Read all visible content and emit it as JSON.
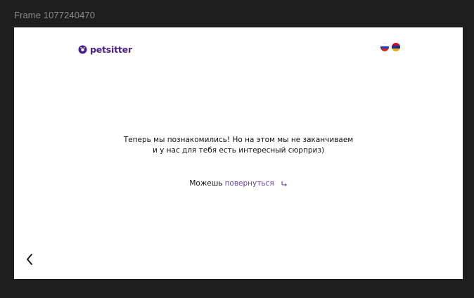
{
  "canvas": {
    "frame_label": "Frame 1077240470"
  },
  "header": {
    "logo_text": "petsitter",
    "brand_color": "#4a1f8a",
    "languages": [
      {
        "name": "ru-flag-icon",
        "colors": [
          "#ffffff",
          "#1f3fbf",
          "#d52b1e"
        ]
      },
      {
        "name": "am-flag-icon",
        "colors": [
          "#d90012",
          "#0033a0",
          "#f2a800"
        ]
      }
    ]
  },
  "main": {
    "message_line1": "Теперь мы познакомились! Но на этом мы не заканчиваем",
    "message_line2": "и у нас для тебя есть интересный сюрприз)",
    "return_prefix": "Можешь",
    "return_link": "повернуться",
    "link_color": "#6b3fa0"
  },
  "nav": {
    "back_icon": "chevron-left-icon"
  }
}
